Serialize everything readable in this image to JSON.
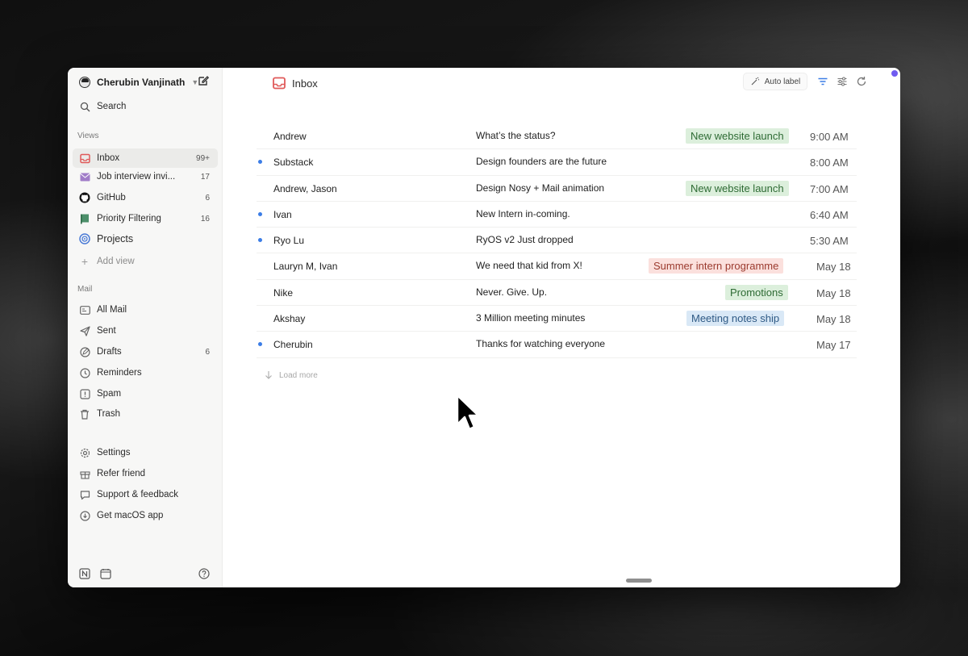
{
  "account": {
    "name": "Cherubin Vanjinath"
  },
  "search": {
    "label": "Search"
  },
  "sections": {
    "views": "Views",
    "mail": "Mail"
  },
  "views": [
    {
      "label": "Inbox",
      "count": "99+"
    },
    {
      "label": "Job interview invi...",
      "count": "17"
    },
    {
      "label": "GitHub",
      "count": "6"
    },
    {
      "label": "Priority Filtering",
      "count": "16"
    },
    {
      "label": "Projects",
      "count": ""
    },
    {
      "label": "Add view",
      "count": ""
    }
  ],
  "mail": [
    {
      "label": "All Mail",
      "count": ""
    },
    {
      "label": "Sent",
      "count": ""
    },
    {
      "label": "Drafts",
      "count": "6"
    },
    {
      "label": "Reminders",
      "count": ""
    },
    {
      "label": "Spam",
      "count": ""
    },
    {
      "label": "Trash",
      "count": ""
    }
  ],
  "utility": [
    {
      "label": "Settings"
    },
    {
      "label": "Refer friend"
    },
    {
      "label": "Support & feedback"
    },
    {
      "label": "Get macOS app"
    }
  ],
  "header": {
    "title": "Inbox",
    "auto_label": "Auto label"
  },
  "colors": {
    "inbox_red": "#e05a5a",
    "label_green_bg": "#dcefdc",
    "label_green_text": "#2e6b34",
    "label_red_bg": "#fbe0dd",
    "label_red_text": "#9b3a2e",
    "label_blue_bg": "#d9e8f6",
    "label_blue_text": "#2f5a85",
    "unread_dot": "#3b7de6",
    "status_dot": "#6f5bf0"
  },
  "emails": [
    {
      "sender": "Andrew",
      "subject": "What’s the status?",
      "label": "New website launch",
      "label_color": "green",
      "time": "9:00 AM",
      "unread": false
    },
    {
      "sender": "Substack",
      "subject": "Design founders are the future",
      "label": "",
      "label_color": "",
      "time": "8:00 AM",
      "unread": true
    },
    {
      "sender": "Andrew, Jason",
      "subject": "Design Nosy + Mail animation",
      "label": "New website launch",
      "label_color": "green",
      "time": "7:00 AM",
      "unread": false
    },
    {
      "sender": "Ivan",
      "subject": "New Intern in-coming.",
      "label": "",
      "label_color": "",
      "time": "6:40 AM",
      "unread": true
    },
    {
      "sender": "Ryo Lu",
      "subject": "RyOS v2 Just dropped",
      "label": "",
      "label_color": "",
      "time": "5:30 AM",
      "unread": true
    },
    {
      "sender": "Lauryn M, Ivan",
      "subject": "We need that kid from X!",
      "label": "Summer intern programme",
      "label_color": "red",
      "time": "May 18",
      "unread": false
    },
    {
      "sender": "Nike",
      "subject": "Never. Give. Up.",
      "label": "Promotions",
      "label_color": "green",
      "time": "May 18",
      "unread": false
    },
    {
      "sender": "Akshay",
      "subject": "3 Million meeting minutes",
      "label": "Meeting notes ship",
      "label_color": "blue",
      "time": "May 18",
      "unread": false
    },
    {
      "sender": "Cherubin",
      "subject": "Thanks for watching everyone",
      "label": "",
      "label_color": "",
      "time": "May 17",
      "unread": true
    }
  ],
  "load_more": "Load more"
}
